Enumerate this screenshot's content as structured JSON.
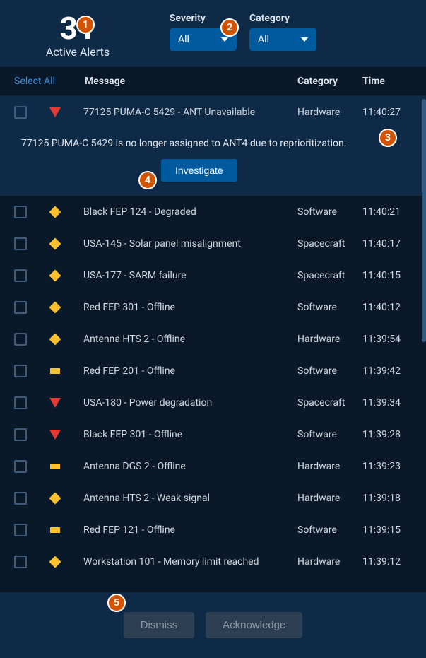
{
  "header": {
    "count": "31",
    "count_label": "Active Alerts",
    "filters": {
      "severity": {
        "label": "Severity",
        "value": "All"
      },
      "category": {
        "label": "Category",
        "value": "All"
      }
    }
  },
  "table": {
    "select_all": "Select All",
    "columns": {
      "message": "Message",
      "category": "Category",
      "time": "Time"
    }
  },
  "expanded": {
    "detail": "77125 PUMA-C 5429 is no longer assigned to ANT4 due to reprioritization.",
    "investigate": "Investigate"
  },
  "alerts": [
    {
      "severity": "critical",
      "message": "77125 PUMA-C 5429 - ANT Unavailable",
      "category": "Hardware",
      "time": "11:40:27",
      "selected": true
    },
    {
      "severity": "serious",
      "message": "Black FEP 124 - Degraded",
      "category": "Software",
      "time": "11:40:21"
    },
    {
      "severity": "serious",
      "message": "USA-145 - Solar panel misalignment",
      "category": "Spacecraft",
      "time": "11:40:17"
    },
    {
      "severity": "serious",
      "message": "USA-177 - SARM failure",
      "category": "Spacecraft",
      "time": "11:40:15"
    },
    {
      "severity": "serious",
      "message": "Red FEP 301 - Offline",
      "category": "Software",
      "time": "11:40:12"
    },
    {
      "severity": "serious",
      "message": "Antenna HTS 2 - Offline",
      "category": "Hardware",
      "time": "11:39:54"
    },
    {
      "severity": "caution",
      "message": "Red FEP 201 - Offline",
      "category": "Software",
      "time": "11:39:42"
    },
    {
      "severity": "critical",
      "message": "USA-180 - Power degradation",
      "category": "Spacecraft",
      "time": "11:39:34"
    },
    {
      "severity": "critical",
      "message": "Black FEP 301 - Offline",
      "category": "Software",
      "time": "11:39:28"
    },
    {
      "severity": "caution",
      "message": "Antenna DGS 2 - Offline",
      "category": "Hardware",
      "time": "11:39:23"
    },
    {
      "severity": "serious",
      "message": "Antenna HTS 2 - Weak signal",
      "category": "Hardware",
      "time": "11:39:18"
    },
    {
      "severity": "caution",
      "message": "Red FEP 121 - Offline",
      "category": "Software",
      "time": "11:39:15"
    },
    {
      "severity": "serious",
      "message": "Workstation 101 - Memory limit reached",
      "category": "Hardware",
      "time": "11:39:12"
    }
  ],
  "footer": {
    "dismiss": "Dismiss",
    "acknowledge": "Acknowledge"
  },
  "annotations": [
    "1",
    "2",
    "3",
    "4",
    "5"
  ]
}
